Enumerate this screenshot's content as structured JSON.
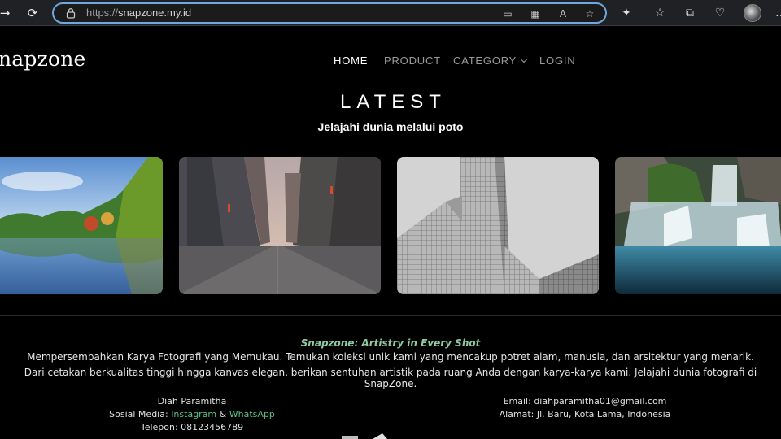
{
  "browser": {
    "url_protocol": "https://",
    "url_host": "snapzone.my.id"
  },
  "site": {
    "brand": "napzone",
    "nav": [
      {
        "label": "HOME",
        "active": true
      },
      {
        "label": "PRODUCT",
        "active": false
      },
      {
        "label": "CATEGORY",
        "active": false
      },
      {
        "label": "LOGIN",
        "active": false
      }
    ]
  },
  "hero": {
    "title": "LATEST",
    "subtitle": "Jelajahi dunia melalui poto"
  },
  "gallery": [
    {
      "subject": "lake-landscape"
    },
    {
      "subject": "city-street"
    },
    {
      "subject": "architecture-bw"
    },
    {
      "subject": "waterfall"
    }
  ],
  "footer": {
    "tagline": "Snapzone: Artistry in Every Shot",
    "desc_line1": "Mempersembahkan Karya Fotografi yang Memukau. Temukan koleksi unik kami yang mencakup potret alam, manusia, dan arsitektur yang menarik.",
    "desc_line2": "Dari cetakan berkualitas tinggi hingga kanvas elegan, berikan sentuhan artistik pada ruang Anda dengan karya-karya kami. Jelajahi dunia fotografi di SnapZone.",
    "name": "Diah Paramitha",
    "social_prefix": "Sosial Media: ",
    "instagram": "Instagram",
    "social_amp": " & ",
    "whatsapp": "WhatsApp",
    "phone": "Telepon: 08123456789",
    "email": "Email: diahparamitha01@gmail.com",
    "address": "Alamat: Jl. Baru, Kota Lama, Indonesia"
  },
  "colors": {
    "accent_link": "#5cc08a",
    "tagline": "#8fc9a0",
    "address_focus": "#6ea8e0"
  }
}
